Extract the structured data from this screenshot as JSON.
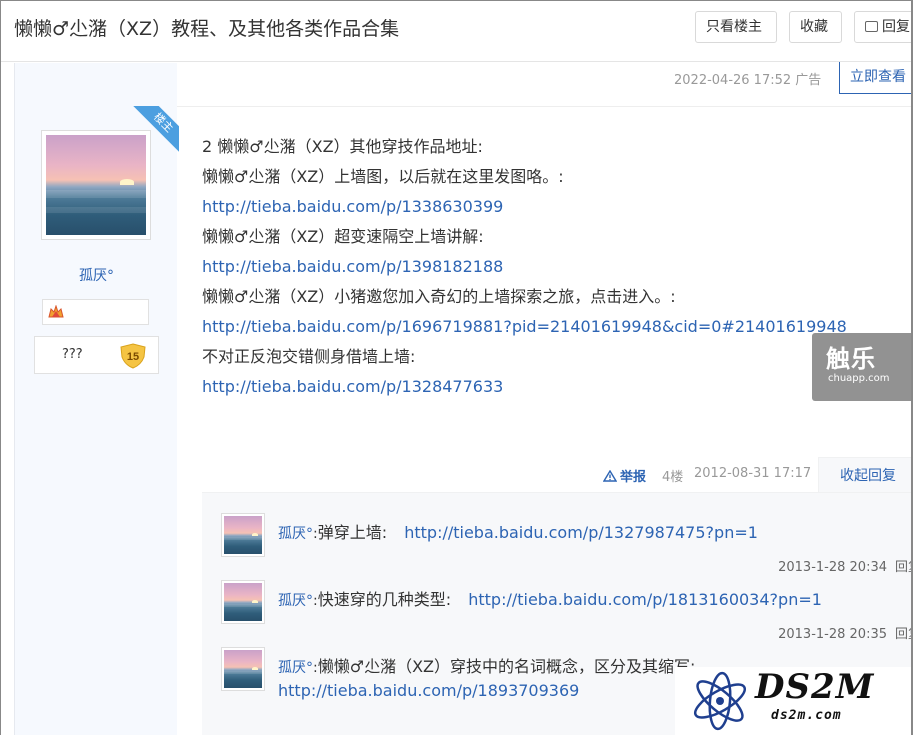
{
  "header": {
    "title": "懒懒♂尐潴（XZ）教程、及其他各类作品合集",
    "only_op_label": "只看楼主",
    "favorite_label": "收藏",
    "reply_label": "回复"
  },
  "ad_meta": {
    "time": "2022-04-26 17:52",
    "ad_label": "广告",
    "view_now_label": "立即查看"
  },
  "author": {
    "badge": "楼主",
    "name": "孤厌°",
    "level_name": "???",
    "level": "15"
  },
  "post": {
    "lines": [
      {
        "text": "2 懒懒♂尐潴（XZ）其他穿技作品地址:",
        "link": false
      },
      {
        "text": "懒懒♂尐潴（XZ）上墙图，以后就在这里发图咯。:",
        "link": false
      },
      {
        "text": "http://tieba.baidu.com/p/1338630399",
        "link": true
      },
      {
        "text": "懒懒♂尐潴（XZ）超变速隔空上墙讲解:",
        "link": false
      },
      {
        "text": "http://tieba.baidu.com/p/1398182188",
        "link": true
      },
      {
        "text": "懒懒♂尐潴（XZ）小猪邀您加入奇幻的上墙探索之旅，点击进入。:",
        "link": false
      },
      {
        "text": "http://tieba.baidu.com/p/1696719881?pid=21401619948&cid=0#21401619948",
        "link": true
      },
      {
        "text": "不对正反泡交错侧身借墙上墙:",
        "link": false
      },
      {
        "text": "http://tieba.baidu.com/p/1328477633",
        "link": true
      }
    ],
    "report_label": "举报",
    "floor": "4楼",
    "time": "2012-08-31 17:17",
    "fold_label": "收起回复"
  },
  "sub_replies": [
    {
      "user": "孤厌°",
      "sep": ":",
      "text": "弹穿上墙:",
      "link": "http://tieba.baidu.com/p/1327987475?pn=1",
      "time": "2013-1-28 20:34",
      "reply": "回复"
    },
    {
      "user": "孤厌°",
      "sep": ":",
      "text": "快速穿的几种类型:",
      "link": "http://tieba.baidu.com/p/1813160034?pn=1",
      "time": "2013-1-28 20:35",
      "reply": "回复"
    },
    {
      "user": "孤厌°",
      "sep": ":",
      "text": "懒懒♂尐潴（XZ）穿技中的名词概念，区分及其缩写:",
      "link": "http://tieba.baidu.com/p/1893709369"
    }
  ],
  "watermarks": {
    "chuapp_big": "触乐",
    "chuapp_small": "chuapp.com",
    "ds2m_big": "DS2M",
    "ds2m_small": "ds2m.com"
  },
  "colors": {
    "link": "#2d64b3",
    "badge": "#4c9fe0",
    "sidebar_bg": "#f6f9fe",
    "sub_bg": "#f7f8fa"
  }
}
